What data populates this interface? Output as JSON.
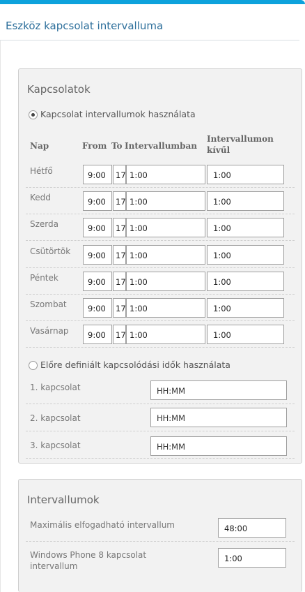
{
  "page": {
    "title": "Eszköz kapcsolat intervalluma"
  },
  "connections": {
    "title": "Kapcsolatok",
    "use_intervals_label": "Kapcsolat intervallumok használata",
    "use_intervals_selected": true,
    "columns": {
      "day": "Nap",
      "from": "From",
      "to": "To",
      "in": "Intervallumban",
      "out": "Intervallumon kívűl"
    },
    "rows": [
      {
        "day": "Hétfő",
        "from": "9:00",
        "to": "17:",
        "in": "1:00",
        "out": "1:00"
      },
      {
        "day": "Kedd",
        "from": "9:00",
        "to": "17:",
        "in": "1:00",
        "out": "1:00"
      },
      {
        "day": "Szerda",
        "from": "9:00",
        "to": "17:",
        "in": "1:00",
        "out": "1:00"
      },
      {
        "day": "Csütörtök",
        "from": "9:00",
        "to": "17:",
        "in": "1:00",
        "out": "1:00"
      },
      {
        "day": "Péntek",
        "from": "9:00",
        "to": "17:",
        "in": "1:00",
        "out": "1:00"
      },
      {
        "day": "Szombat",
        "from": "9:00",
        "to": "17:",
        "in": "1:00",
        "out": "1:00"
      },
      {
        "day": "Vasárnap",
        "from": "9:00",
        "to": "17:",
        "in": "1:00",
        "out": "1:00"
      }
    ],
    "predefined_label": "Előre definiált kapcsolódási idők használata",
    "predefined_selected": false,
    "predefined": [
      {
        "label": "1. kapcsolat",
        "value": "HH:MM"
      },
      {
        "label": "2. kapcsolat",
        "value": "HH:MM"
      },
      {
        "label": "3. kapcsolat",
        "value": "HH:MM"
      }
    ]
  },
  "intervals": {
    "title": "Intervallumok",
    "max_label": "Maximális elfogadható intervallum",
    "max_value": "48:00",
    "wp8_label": "Windows Phone 8 kapcsolat intervallum",
    "wp8_value": "1:00"
  },
  "colors": {
    "accent": "#0da2dc",
    "title": "#2d6f9b",
    "panel_bg": "#f2f2f2"
  }
}
